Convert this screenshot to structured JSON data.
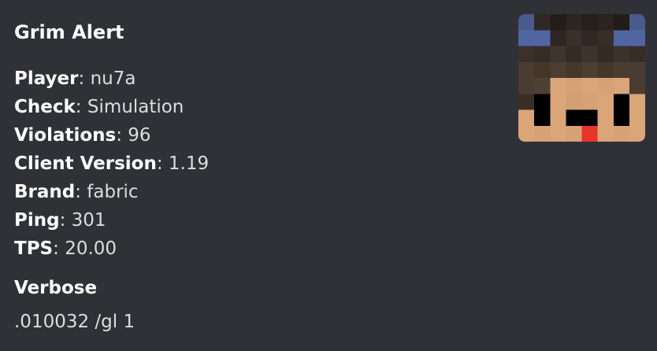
{
  "embed": {
    "title": "Grim Alert",
    "fields": [
      {
        "name": "Player",
        "value": "nu7a"
      },
      {
        "name": "Check",
        "value": "Simulation"
      },
      {
        "name": "Violations",
        "value": "96"
      },
      {
        "name": "Client Version",
        "value": "1.19"
      },
      {
        "name": "Brand",
        "value": "fabric"
      },
      {
        "name": "Ping",
        "value": "301"
      },
      {
        "name": "TPS",
        "value": "20.00"
      }
    ],
    "verbose_label": "Verbose",
    "verbose_value": ".010032 /gl 1",
    "thumbnail": {
      "icon": "minecraft-player-head-icon"
    }
  }
}
